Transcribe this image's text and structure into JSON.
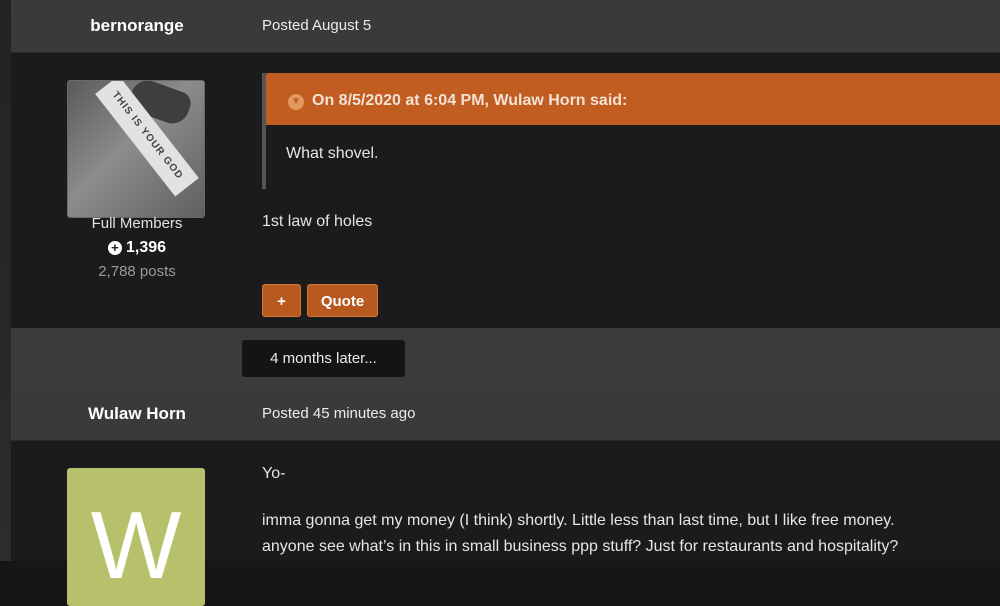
{
  "posts": [
    {
      "author": "bernorange",
      "posted": "Posted August 5",
      "member_group": "Full Members",
      "reputation": "1,396",
      "post_count": "2,788 posts",
      "avatar_caption": "THIS IS YOUR GOD",
      "quote": {
        "header": "On 8/5/2020 at 6:04 PM, Wulaw Horn said:",
        "text": "What shovel."
      },
      "body": "1st law of holes",
      "buttons": {
        "plus": "+",
        "quote": "Quote"
      }
    },
    {
      "author": "Wulaw Horn",
      "posted": "Posted 45 minutes ago",
      "avatar_letter": "W",
      "avatar_color": "#b7c06a",
      "body_lines": [
        "Yo-",
        "imma gonna get my money (I think) shortly. Little less than last time, but I like free money.",
        "anyone see what’s in this in small business ppp stuff?  Just for restaurants and hospitality?"
      ]
    }
  ],
  "time_gap": "4 months later...",
  "icons": {
    "reputation": "plus-circle-icon",
    "quote_toggle": "chevron-down-circle-icon"
  },
  "colors": {
    "accent": "#c15d21",
    "button": "#b85a20"
  }
}
